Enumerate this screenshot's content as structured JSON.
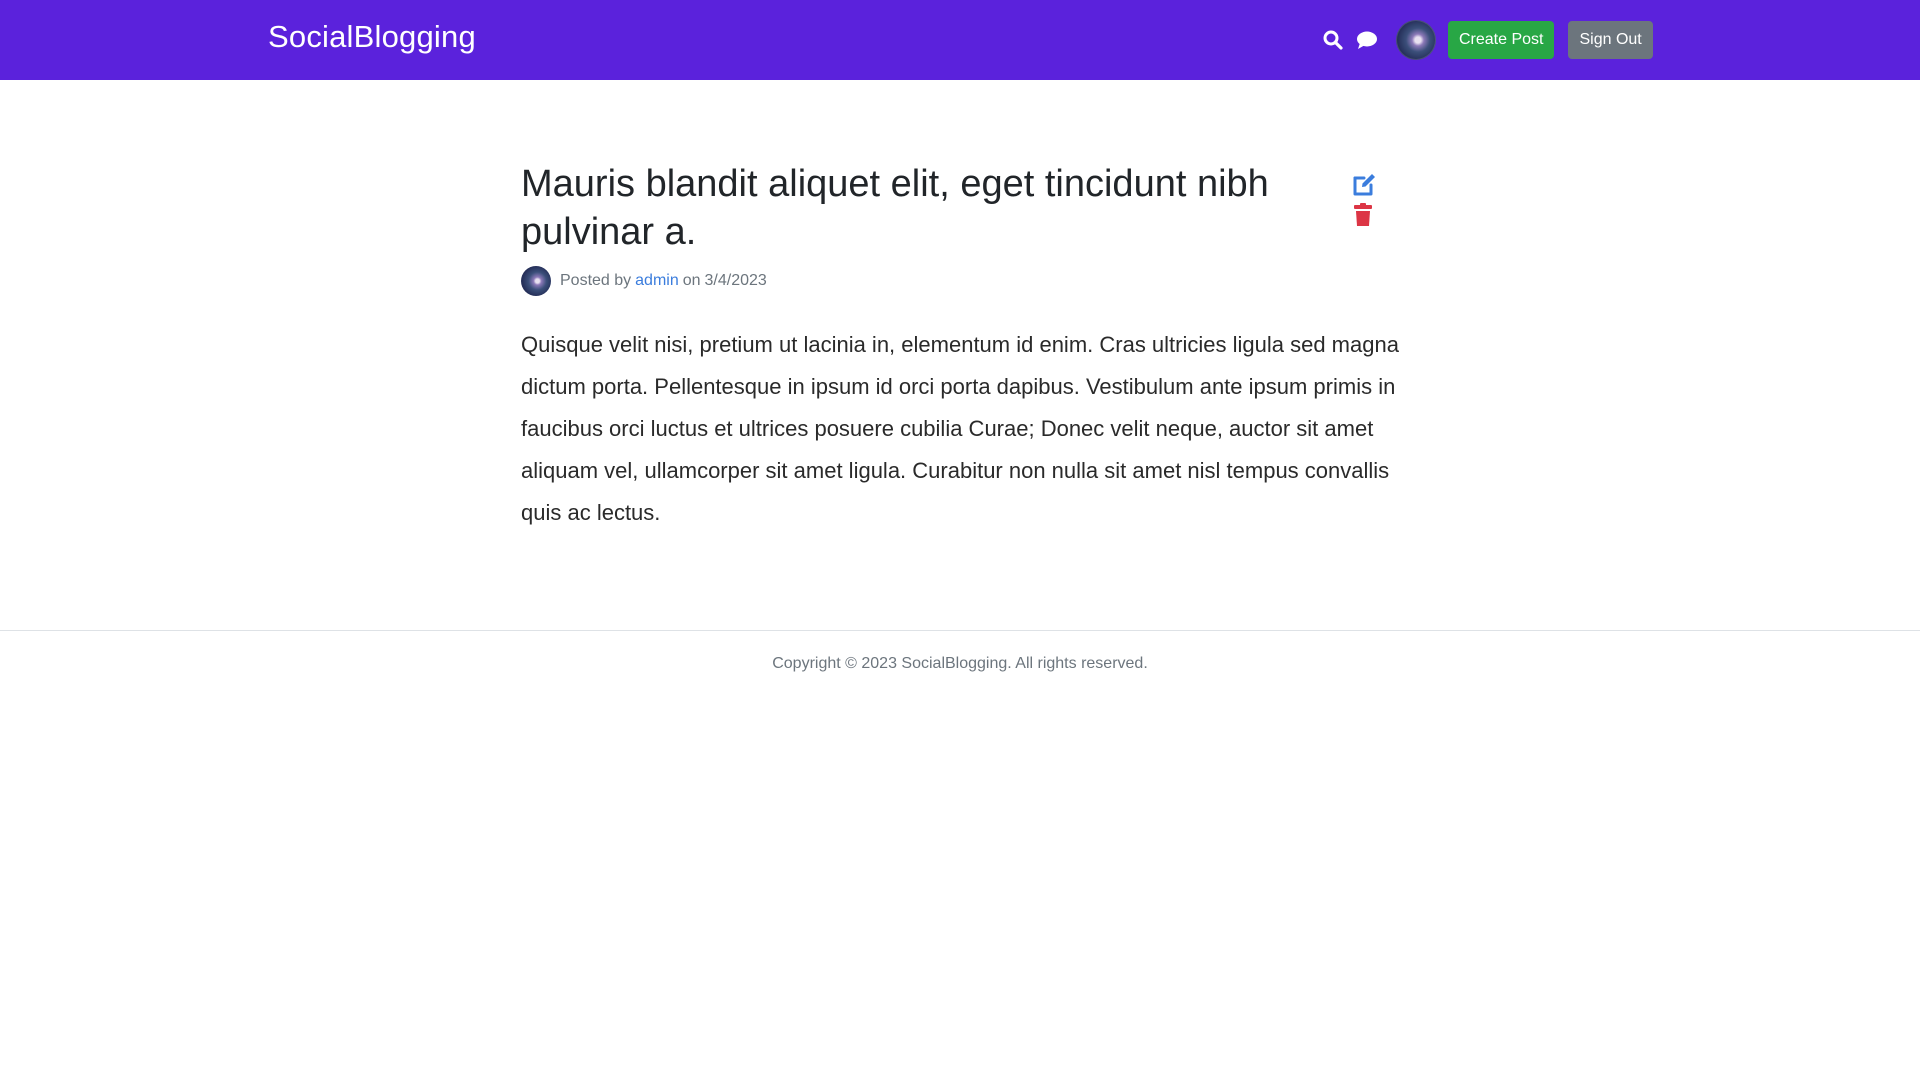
{
  "navbar": {
    "brand": "SocialBlogging",
    "icons": [
      "search-icon",
      "comment-icon"
    ],
    "create_post_label": "Create Post",
    "sign_out_label": "Sign Out",
    "colors": {
      "background": "#5b22dc",
      "create": "#28a745",
      "signout": "#6c757d"
    }
  },
  "post": {
    "title": "Mauris blandit aliquet elit, eget tincidunt nibh pulvinar a.",
    "meta": {
      "posted_by_label": "Posted by",
      "author": "admin",
      "on_label": "on",
      "date": "3/4/2023"
    },
    "body": "Quisque velit nisi, pretium ut lacinia in, elementum id enim. Cras ultricies ligula sed magna dictum porta. Pellentesque in ipsum id orci porta dapibus. Vestibulum ante ipsum primis in faucibus orci luctus et ultrices posuere cubilia Curae; Donec velit neque, auctor sit amet aliquam vel, ullamcorper sit amet ligula. Curabitur non nulla sit amet nisl tempus convallis quis ac lectus.",
    "actions": {
      "edit_icon": "edit-icon",
      "delete_icon": "trash-icon",
      "colors": {
        "edit": "#3b7ddd",
        "delete": "#dc3545"
      }
    }
  },
  "footer": {
    "copyright": "Copyright © 2023 SocialBlogging. All rights reserved."
  }
}
